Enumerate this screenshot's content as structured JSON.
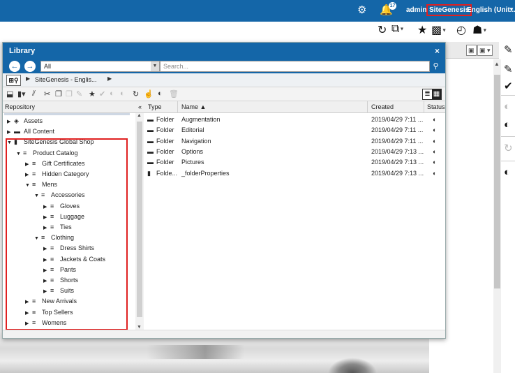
{
  "topbar": {
    "user": "admin",
    "site": "SiteGenesis",
    "locale": "English (Unit...",
    "notification_count": "17"
  },
  "dialog": {
    "title": "Library",
    "close": "×",
    "nav": {
      "scope_value": "All",
      "search_placeholder": "Search..."
    },
    "breadcrumb": "SiteGenesis - Englis...",
    "tree_header": "Repository",
    "tree_collapse": "«",
    "tree": [
      {
        "label": "Assets",
        "icon": "assets-icon",
        "glyph": "◈",
        "toggle": "▶"
      },
      {
        "label": "All Content",
        "icon": "folder-icon",
        "glyph": "▬",
        "toggle": "▶"
      },
      {
        "label": "SiteGenesis Global Shop",
        "icon": "catalog-book-icon",
        "glyph": "▮",
        "toggle": "▼"
      },
      {
        "label": "Product Catalog",
        "icon": "catalog-list-icon",
        "glyph": "≡",
        "toggle": "▼"
      },
      {
        "label": "Gift Certificates",
        "icon": "category-icon",
        "glyph": "≡",
        "toggle": "▶"
      },
      {
        "label": "Hidden Category",
        "icon": "category-icon",
        "glyph": "≡",
        "toggle": "▶"
      },
      {
        "label": "Mens",
        "icon": "category-icon",
        "glyph": "≡",
        "toggle": "▼"
      },
      {
        "label": "Accessories",
        "icon": "category-icon",
        "glyph": "≡",
        "toggle": "▼"
      },
      {
        "label": "Gloves",
        "icon": "category-icon",
        "glyph": "≡",
        "toggle": "▶"
      },
      {
        "label": "Luggage",
        "icon": "category-icon",
        "glyph": "≡",
        "toggle": "▶"
      },
      {
        "label": "Ties",
        "icon": "category-icon",
        "glyph": "≡",
        "toggle": "▶"
      },
      {
        "label": "Clothing",
        "icon": "category-icon",
        "glyph": "≡",
        "toggle": "▼"
      },
      {
        "label": "Dress Shirts",
        "icon": "category-icon",
        "glyph": "≡",
        "toggle": "▶"
      },
      {
        "label": "Jackets & Coats",
        "icon": "category-icon",
        "glyph": "≡",
        "toggle": "▶"
      },
      {
        "label": "Pants",
        "icon": "category-icon",
        "glyph": "≡",
        "toggle": "▶"
      },
      {
        "label": "Shorts",
        "icon": "category-icon",
        "glyph": "≡",
        "toggle": "▶"
      },
      {
        "label": "Suits",
        "icon": "category-icon",
        "glyph": "≡",
        "toggle": "▶"
      },
      {
        "label": "New Arrivals",
        "icon": "category-icon",
        "glyph": "≡",
        "toggle": "▶"
      },
      {
        "label": "Top Sellers",
        "icon": "category-icon",
        "glyph": "≡",
        "toggle": "▶"
      },
      {
        "label": "Womens",
        "icon": "category-icon",
        "glyph": "≡",
        "toggle": "▶"
      }
    ],
    "grid": {
      "columns": [
        "Type",
        "Name ▲",
        "Created",
        "Status"
      ],
      "rows": [
        {
          "type": "Folder",
          "name": "Augmentation",
          "created": "2019/04/29 7:11 ..."
        },
        {
          "type": "Folder",
          "name": "Editorial",
          "created": "2019/04/29 7:11 ..."
        },
        {
          "type": "Folder",
          "name": "Navigation",
          "created": "2019/04/29 7:11 ..."
        },
        {
          "type": "Folder",
          "name": "Options",
          "created": "2019/04/29 7:13 ..."
        },
        {
          "type": "Folder",
          "name": "Pictures",
          "created": "2019/04/29 7:13 ..."
        },
        {
          "type": "Folde...",
          "name": "_folderProperties",
          "created": "2019/04/29 7:13 ..."
        }
      ]
    }
  },
  "colors": {
    "brand_blue": "#1466a8",
    "highlight_red": "#e02020"
  }
}
